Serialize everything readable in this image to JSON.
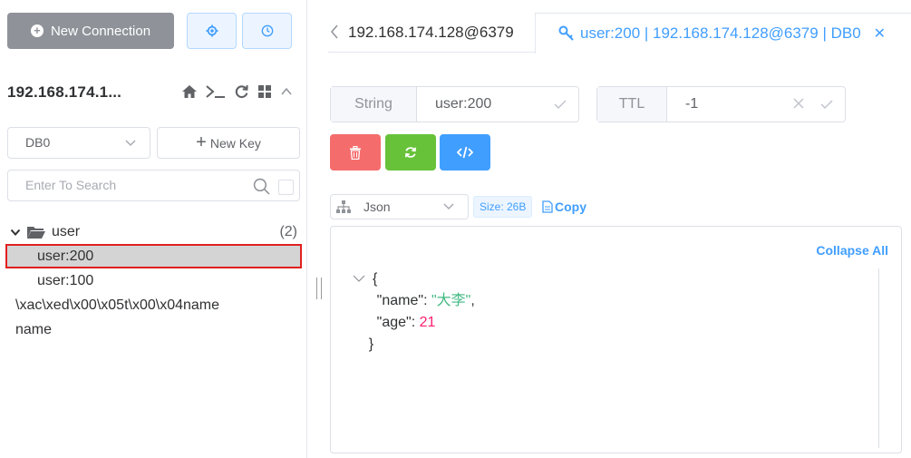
{
  "sidebar": {
    "new_connection_label": "New Connection",
    "connection_name": "192.168.174.1...",
    "db_select_value": "DB0",
    "new_key_label": "New Key",
    "search_placeholder": "Enter To Search",
    "tree": {
      "folder_name": "user",
      "folder_count": "(2)",
      "children": [
        "user:200",
        "user:100"
      ],
      "root_keys": [
        "\\xac\\xed\\x00\\x05t\\x00\\x04name",
        "name"
      ]
    }
  },
  "tabs": [
    {
      "label": "192.168.174.128@6379"
    },
    {
      "label": "user:200 | 192.168.174.128@6379 | DB0",
      "active": true
    }
  ],
  "key_info": {
    "type_label": "String",
    "key_value": "user:200",
    "ttl_label": "TTL",
    "ttl_value": "-1"
  },
  "viewer": {
    "format_value": "Json",
    "size_label": "Size: 26B",
    "copy_label": "Copy",
    "collapse_all_label": "Collapse All",
    "json": {
      "open_brace": "{",
      "close_brace": "}",
      "name_key": "\"name\"",
      "name_value": "\"大李\"",
      "age_key": "\"age\"",
      "age_value": "21"
    }
  },
  "colors": {
    "primary": "#409eff",
    "danger": "#f56c6c",
    "success": "#67c23a",
    "selected_outline": "#e02020"
  }
}
